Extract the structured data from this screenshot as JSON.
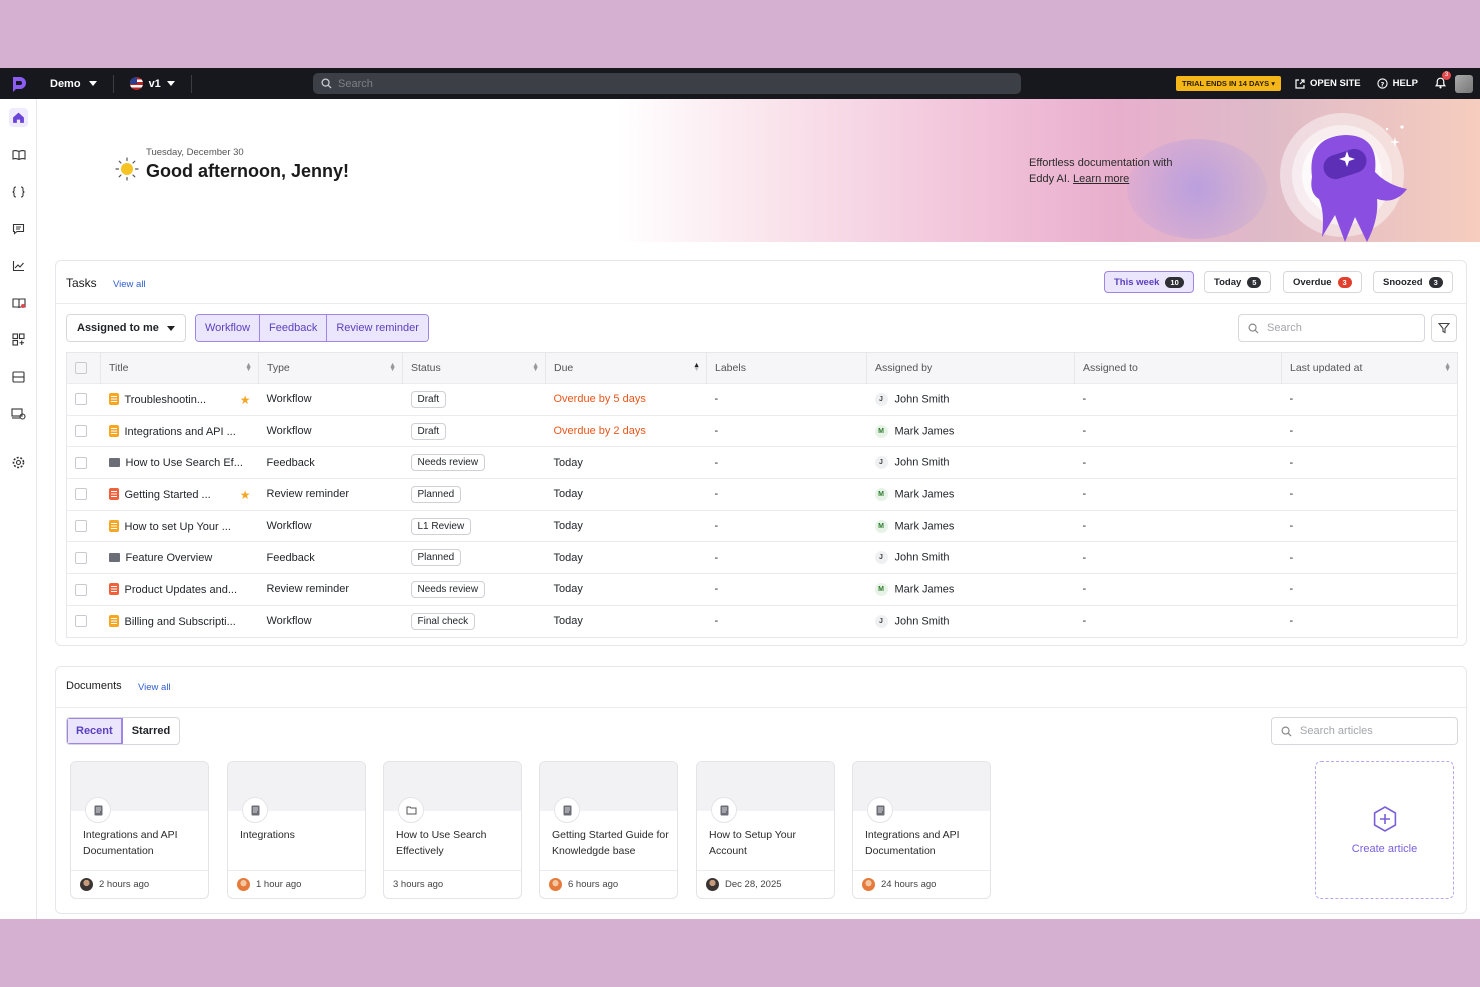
{
  "topbar": {
    "project": "Demo",
    "version": "v1",
    "search_placeholder": "Search",
    "trial": "TRIAL ENDS IN 14 DAYS",
    "open_site": "OPEN SITE",
    "help": "HELP",
    "notifications": "3"
  },
  "sidebar": {
    "items": [
      "home-icon",
      "book-icon",
      "code-icon",
      "chat-icon",
      "analytics-icon",
      "open-book-icon",
      "widgets-icon",
      "layout-icon",
      "devices-icon",
      "settings-icon"
    ]
  },
  "hero": {
    "date": "Tuesday, December 30",
    "greeting": "Good afternoon, Jenny!",
    "promo_text": "Effortless documentation with Eddy AI.",
    "promo_link": "Learn more"
  },
  "tasks": {
    "title": "Tasks",
    "view_all": "View all",
    "filters": [
      {
        "label": "This week",
        "count": "10"
      },
      {
        "label": "Today",
        "count": "5"
      },
      {
        "label": "Overdue",
        "count": "3"
      },
      {
        "label": "Snoozed",
        "count": "3"
      }
    ],
    "assigned_dropdown": "Assigned to me",
    "type_segments": [
      "Workflow",
      "Feedback",
      "Review reminder"
    ],
    "search_placeholder": "Search",
    "columns": [
      "Title",
      "Type",
      "Status",
      "Due",
      "Labels",
      "Assigned by",
      "Assigned to",
      "Last updated at"
    ],
    "rows": [
      {
        "title": "Troubleshootin...",
        "icon": "doc-orange",
        "starred": true,
        "type": "Workflow",
        "status": "Draft",
        "due": "Overdue by 5 days",
        "overdue": true,
        "labels": "-",
        "initial": "J",
        "assigned_by": "John Smith",
        "assigned_to": "-",
        "updated": "-"
      },
      {
        "title": "Integrations and API ...",
        "icon": "doc-orange",
        "starred": false,
        "type": "Workflow",
        "status": "Draft",
        "due": "Overdue by 2 days",
        "overdue": true,
        "labels": "-",
        "initial": "M",
        "assigned_by": "Mark James",
        "assigned_to": "-",
        "updated": "-"
      },
      {
        "title": "How to Use Search Ef...",
        "icon": "chat",
        "starred": false,
        "type": "Feedback",
        "status": "Needs review",
        "due": "Today",
        "overdue": false,
        "labels": "-",
        "initial": "J",
        "assigned_by": "John Smith",
        "assigned_to": "-",
        "updated": "-"
      },
      {
        "title": "Getting Started ...",
        "icon": "doc-red",
        "starred": true,
        "type": "Review reminder",
        "status": "Planned",
        "due": "Today",
        "overdue": false,
        "labels": "-",
        "initial": "M",
        "assigned_by": "Mark James",
        "assigned_to": "-",
        "updated": "-"
      },
      {
        "title": "How to set Up Your ...",
        "icon": "doc-orange",
        "starred": false,
        "type": "Workflow",
        "status": "L1 Review",
        "due": "Today",
        "overdue": false,
        "labels": "-",
        "initial": "M",
        "assigned_by": "Mark James",
        "assigned_to": "-",
        "updated": "-"
      },
      {
        "title": "Feature Overview",
        "icon": "chat",
        "starred": false,
        "type": "Feedback",
        "status": "Planned",
        "due": "Today",
        "overdue": false,
        "labels": "-",
        "initial": "J",
        "assigned_by": "John Smith",
        "assigned_to": "-",
        "updated": "-"
      },
      {
        "title": "Product Updates and...",
        "icon": "doc-red",
        "starred": false,
        "type": "Review reminder",
        "status": "Needs review",
        "due": "Today",
        "overdue": false,
        "labels": "-",
        "initial": "M",
        "assigned_by": "Mark James",
        "assigned_to": "-",
        "updated": "-"
      },
      {
        "title": "Billing and Subscripti...",
        "icon": "doc-orange",
        "starred": false,
        "type": "Workflow",
        "status": "Final check",
        "due": "Today",
        "overdue": false,
        "labels": "-",
        "initial": "J",
        "assigned_by": "John Smith",
        "assigned_to": "-",
        "updated": "-"
      }
    ]
  },
  "documents": {
    "title": "Documents",
    "view_all": "View all",
    "tabs": [
      "Recent",
      "Starred"
    ],
    "search_placeholder": "Search articles",
    "cards": [
      {
        "title": "Integrations and API Documentation",
        "icon": "article",
        "avatar": "a",
        "time": "2 hours ago"
      },
      {
        "title": "Integrations",
        "icon": "article",
        "avatar": "b",
        "time": "1 hour ago"
      },
      {
        "title": "How to Use Search Effectively",
        "icon": "folder",
        "avatar": "",
        "time": "3 hours ago"
      },
      {
        "title": "Getting Started Guide for Knowledgde base",
        "icon": "article",
        "avatar": "b",
        "time": "6 hours ago"
      },
      {
        "title": "How to Setup Your Account",
        "icon": "article",
        "avatar": "a",
        "time": "Dec 28, 2025"
      },
      {
        "title": "Integrations and API Documentation",
        "icon": "article",
        "avatar": "b",
        "time": "24 hours ago"
      }
    ],
    "create_label": "Create article"
  },
  "colors": {
    "accent": "#6b45d8",
    "overdue": "#e8571d",
    "trial": "#f5b619"
  }
}
